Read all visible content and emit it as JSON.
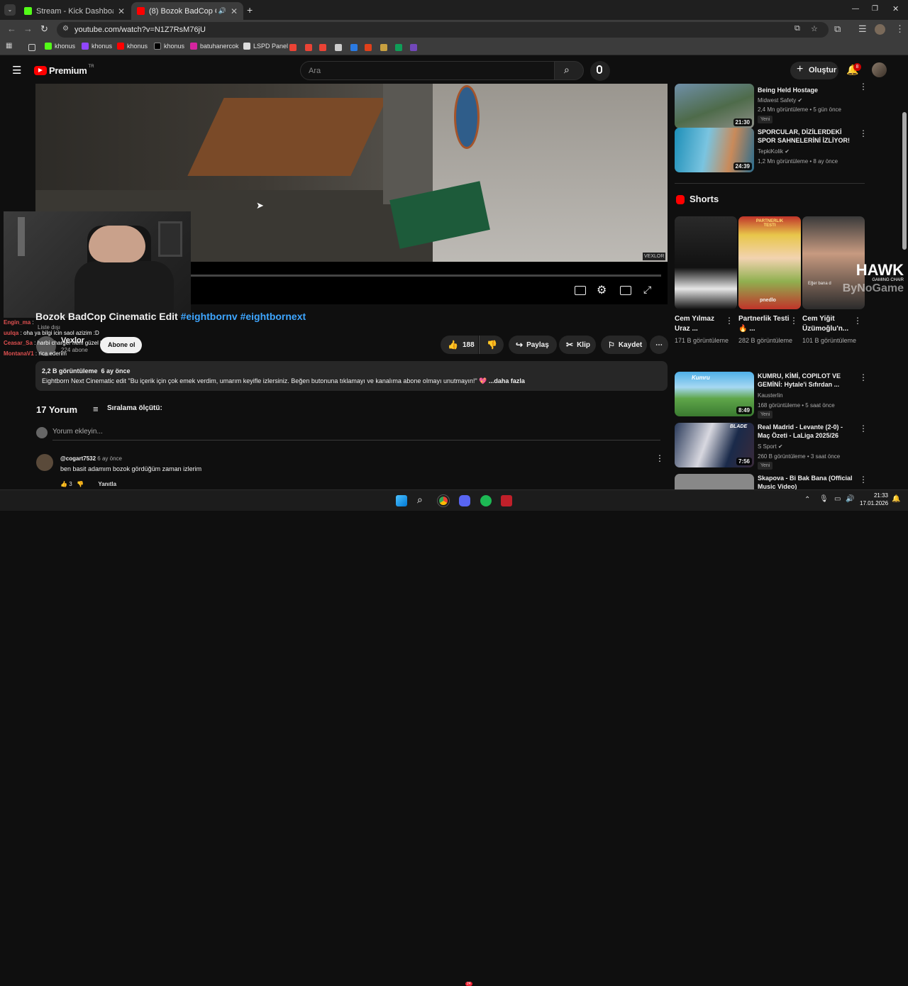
{
  "browser": {
    "tabs": [
      {
        "label": "Stream - Kick Dashboard",
        "active": false
      },
      {
        "label": "(8) Bozok BadCop Cinemati...",
        "active": true
      }
    ],
    "new_tab": "+",
    "url": "youtube.com/watch?v=N1Z7RsM76jU",
    "bookmarks": [
      "khonus",
      "khonus",
      "khonus",
      "khonus",
      "batuhanercok",
      "LSPD Panel"
    ]
  },
  "youtube": {
    "logo": "Premium",
    "logo_region": "TR",
    "search_placeholder": "Ara",
    "create_label": "Oluştur",
    "notifications": "8"
  },
  "video": {
    "watermark": "VEXLOR",
    "title_main": "Bozok BadCop Cinematic Edit ",
    "title_tags": "#eightbornv #eightbornext",
    "channel": "Vexlor",
    "subscribers": "224 abone",
    "subscribe_label": "Abone ol",
    "likes": "188",
    "share": "Paylaş",
    "clip": "Klip",
    "save": "Kaydet",
    "views": "2,2 B görüntüleme",
    "age": "6 ay önce",
    "description": "Eightborn Next Cinematic edit \"Bu içerik için çok emek verdim, umarım keyifle izlersiniz. Beğen butonuna tıklamayı ve kanalıma abone olmayı unutmayın!\" 💖",
    "more": "...daha fazla"
  },
  "chat": [
    {
      "user": "Engin_ma",
      "msg": " : ",
      "color": "#e05050"
    },
    {
      "user": "Liste dışı",
      "msg": "",
      "color": "#aaaaaa"
    },
    {
      "user": "uulqa",
      "msg": " : oha ya bilgi icin saol azizim :D",
      "color": "#e05050"
    },
    {
      "user": "Ceasar_Sa",
      "msg": " : harbi charger hem güzel hem yapan iyi",
      "color": "#e05050"
    },
    {
      "user": "MontanaV1",
      "msg": " : rica ederim",
      "color": "#e05050"
    }
  ],
  "comments": {
    "count": "17 Yorum",
    "sort": "Sıralama ölçütü:",
    "add_placeholder": "Yorum ekleyin...",
    "first": {
      "user": "@cogart7532",
      "time": "6 ay önce",
      "text": "ben basit adamım bozok gördüğüm zaman izlerim",
      "likes": "3",
      "reply": "Yanıtla"
    }
  },
  "sidebar": {
    "videos_top": [
      {
        "title": "Being Held Hostage",
        "channel": "Midwest Safety",
        "meta": "2,4 Mn görüntüleme • 5 gün önce",
        "badge": "Yeni",
        "duration": "21:30"
      },
      {
        "title": "SPORCULAR, DİZİLERDEKİ SPOR SAHNELERİNİ İZLİYOR!",
        "channel": "TepkiKolik",
        "meta": "1,2 Mn görüntüleme • 8 ay önce",
        "badge": "",
        "duration": "24:39"
      }
    ],
    "shorts_header": "Shorts",
    "shorts": [
      {
        "title": "Cem Yılmaz Uraz ...",
        "views": "171 B görüntüleme"
      },
      {
        "title": "Partnerlik Testi 🔥 ...",
        "views": "282 B görüntüleme"
      },
      {
        "title": "Cem Yiğit Üzümoğlu'n...",
        "views": "101 B görüntüleme"
      }
    ],
    "shorts_overlay": {
      "brand": "HAWK",
      "sub": "GAMING CHAIR",
      "footer": "ByNoGame",
      "testi": "PARTNERLIK TESTI",
      "pnedlo": "pnedlo",
      "eger": "Eğer bana d"
    },
    "videos_bottom": [
      {
        "title": "KUMRU, KİMİ, COPILOT VE GEMİNİ: Hytale'i Sıfırdan ...",
        "channel": "Kausterlin",
        "meta": "168 görüntüleme • 5 saat önce",
        "badge": "Yeni",
        "duration": "8:49",
        "thumb_text": "Kumru"
      },
      {
        "title": "Real Madrid - Levante (2-0) - Maç Özeti - LaLiga 2025/26",
        "channel": "S Sport",
        "meta": "260 B görüntüleme • 3 saat önce",
        "badge": "Yeni",
        "duration": "7:56",
        "thumb_text": "BLADE"
      },
      {
        "title": "Skapova - Bi Bak Bana (Official Music Video)",
        "channel": "",
        "meta": "",
        "badge": "",
        "duration": "",
        "thumb_text": ""
      }
    ]
  },
  "taskbar": {
    "time": "21:33",
    "date": "17.01.2026",
    "discord_badge": "24"
  },
  "colors": {
    "yt_red": "#ff0000",
    "link": "#3ea6ff",
    "bg": "#0f0f0f",
    "pill": "#272727"
  }
}
